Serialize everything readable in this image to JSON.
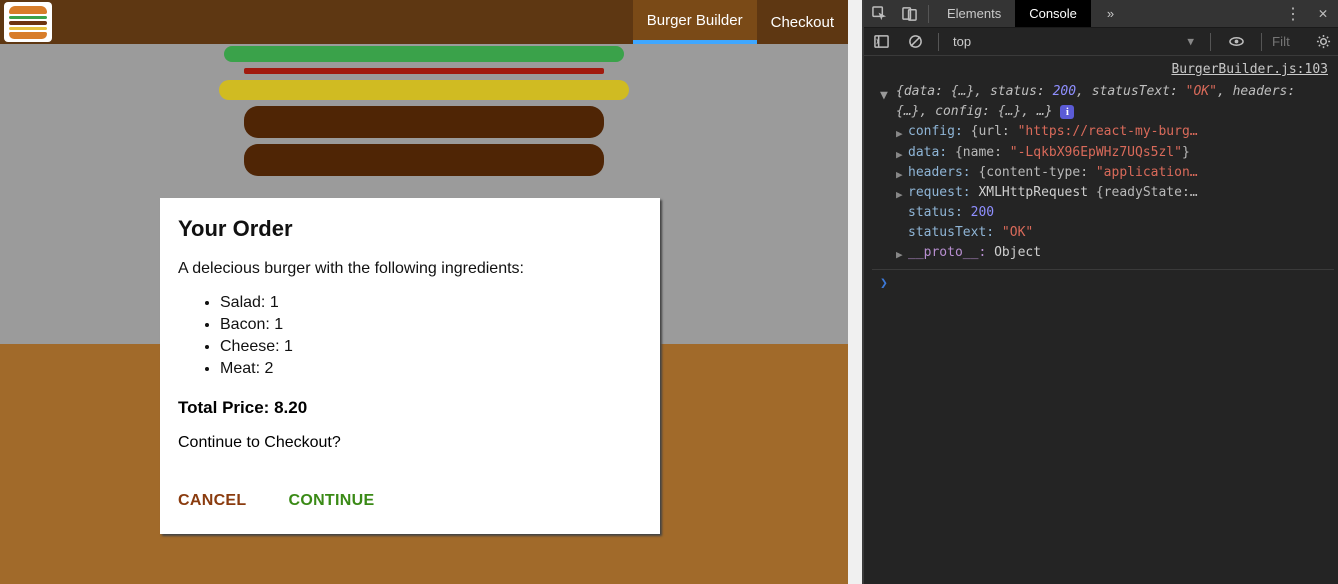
{
  "nav": {
    "items": [
      {
        "label": "Burger Builder",
        "active": true
      },
      {
        "label": "Checkout",
        "active": false
      }
    ]
  },
  "modal": {
    "title": "Your Order",
    "lead": "A delecious burger with the following ingredients:",
    "ingredients": [
      {
        "name": "Salad",
        "qty": 1
      },
      {
        "name": "Bacon",
        "qty": 1
      },
      {
        "name": "Cheese",
        "qty": 1
      },
      {
        "name": "Meat",
        "qty": 2
      }
    ],
    "total_label": "Total Price:",
    "total_value": "8.20",
    "question": "Continue to Checkout?",
    "cancel": "CANCEL",
    "continue": "CONTINUE"
  },
  "devtools": {
    "tabs": {
      "elements": "Elements",
      "console": "Console",
      "more": "»"
    },
    "context": "top",
    "filter_placeholder": "Filt",
    "source_link": "BurgerBuilder.js:103",
    "summary_parts": {
      "open": "{",
      "data": "data:",
      "data_v": "{…}",
      "status": "status:",
      "status_v": "200",
      "statusText": "statusText:",
      "statusText_v": "\"OK\"",
      "headers": "headers:",
      "headers_v": "{…}",
      "config": "config:",
      "config_v": "{…}",
      "rest": ", …}"
    },
    "props": {
      "config_k": "config:",
      "config_v_pre": "{url:",
      "config_v_str": "\"https://react-my-burg…",
      "data_k": "data:",
      "data_v_pre": "{name:",
      "data_v_str": "\"-LqkbX96EpWHz7UQs5zl\"",
      "data_v_post": "}",
      "headers_k": "headers:",
      "headers_v_pre": "{content-type:",
      "headers_v_str": "\"application…",
      "request_k": "request:",
      "request_type": "XMLHttpRequest",
      "request_rest": "{readyState:…",
      "status_k": "status:",
      "status_v": "200",
      "statusText_k": "statusText:",
      "statusText_v": "\"OK\"",
      "proto_k": "__proto__:",
      "proto_v": "Object"
    }
  }
}
